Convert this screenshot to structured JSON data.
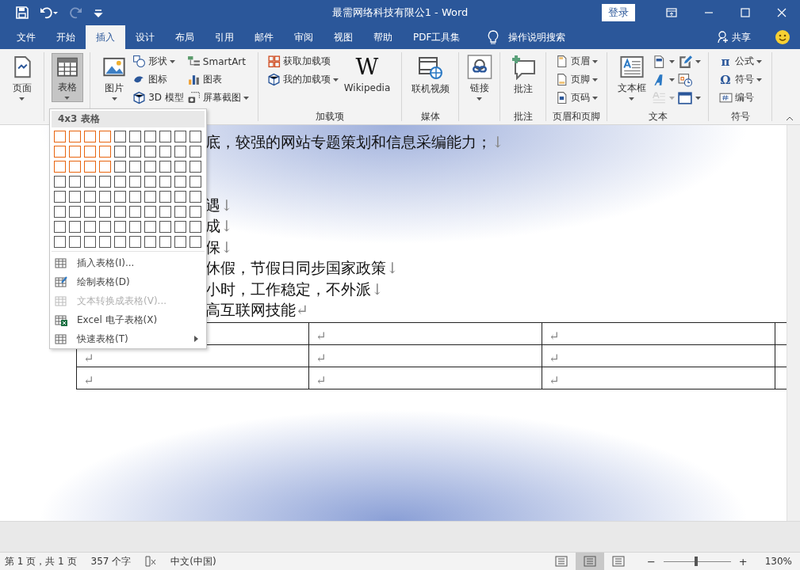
{
  "window": {
    "title": "最需网络科技有限公1  -  Word",
    "login": "登录"
  },
  "tabs": [
    {
      "label": "文件",
      "selected": false
    },
    {
      "label": "开始",
      "selected": false
    },
    {
      "label": "插入",
      "selected": true
    },
    {
      "label": "设计",
      "selected": false
    },
    {
      "label": "布局",
      "selected": false
    },
    {
      "label": "引用",
      "selected": false
    },
    {
      "label": "邮件",
      "selected": false
    },
    {
      "label": "审阅",
      "selected": false
    },
    {
      "label": "视图",
      "selected": false
    },
    {
      "label": "帮助",
      "selected": false
    },
    {
      "label": "PDF工具集",
      "selected": false
    }
  ],
  "tell_me": "操作说明搜索",
  "share": "共享",
  "ribbon": {
    "groups": [
      {
        "columns": [
          [
            {
              "kind": "large",
              "label": "页面",
              "dropdown": true,
              "pressed": false
            }
          ]
        ]
      },
      {
        "columns": [
          [
            {
              "kind": "large",
              "label": "表格",
              "dropdown": true,
              "pressed": true
            }
          ]
        ]
      },
      {
        "columns": [
          [
            {
              "kind": "large",
              "label": "图片",
              "dropdown": true,
              "pressed": false
            }
          ],
          [
            {
              "kind": "small",
              "label": "形状",
              "dropdown": true
            },
            {
              "kind": "small",
              "label": "图标",
              "dropdown": false
            },
            {
              "kind": "small",
              "label": "3D 模型",
              "dropdown": false
            }
          ],
          [
            {
              "kind": "small",
              "label": "SmartArt",
              "dropdown": false
            },
            {
              "kind": "small",
              "label": "图表",
              "dropdown": false
            },
            {
              "kind": "small",
              "label": "屏幕截图",
              "dropdown": true
            }
          ]
        ]
      },
      {
        "label": "加载项",
        "columns": [
          [
            {
              "kind": "small",
              "label": "获取加载项",
              "dropdown": false
            },
            {
              "kind": "small",
              "label": "我的加载项",
              "dropdown": true
            }
          ],
          [
            {
              "kind": "large",
              "label": "Wikipedia",
              "glyph": "W",
              "dropdown": false,
              "pressed": false
            }
          ]
        ]
      },
      {
        "label": "媒体",
        "columns": [
          [
            {
              "kind": "large",
              "label": "联机视频",
              "dropdown": false,
              "pressed": false
            }
          ]
        ]
      },
      {
        "columns": [
          [
            {
              "kind": "large",
              "label": "链接",
              "dropdown": true,
              "pressed": false
            }
          ]
        ]
      },
      {
        "label": "批注",
        "columns": [
          [
            {
              "kind": "large",
              "label": "批注",
              "dropdown": false,
              "pressed": false
            }
          ]
        ]
      },
      {
        "label": "页眉和页脚",
        "columns": [
          [
            {
              "kind": "small",
              "label": "页眉",
              "dropdown": true
            },
            {
              "kind": "small",
              "label": "页脚",
              "dropdown": true
            },
            {
              "kind": "small",
              "label": "页码",
              "dropdown": true
            }
          ]
        ]
      },
      {
        "label": "文本",
        "columns": [
          [
            {
              "kind": "large",
              "label": "文本框",
              "dropdown": true,
              "pressed": false
            }
          ],
          [
            {
              "kind": "icon",
              "dropdown": true,
              "disabled": false
            },
            {
              "kind": "icon",
              "dropdown": true,
              "disabled": false
            },
            {
              "kind": "icon",
              "dropdown": true,
              "disabled": true
            }
          ],
          [
            {
              "kind": "icon",
              "dropdown": true,
              "disabled": false
            },
            {
              "kind": "icon",
              "dropdown": false,
              "disabled": false
            },
            {
              "kind": "icon",
              "dropdown": true,
              "disabled": false
            }
          ]
        ]
      },
      {
        "label": "符号",
        "columns": [
          [
            {
              "kind": "small",
              "label": "公式",
              "glyph": "π",
              "dropdown": true
            },
            {
              "kind": "small",
              "label": "符号",
              "glyph": "Ω",
              "dropdown": true
            },
            {
              "kind": "small",
              "label": "编号",
              "dropdown": false
            }
          ]
        ]
      }
    ]
  },
  "table_menu": {
    "title": "4x3 表格",
    "grid": [
      [
        {
          "selected": true
        },
        {
          "selected": true
        },
        {
          "selected": true
        },
        {
          "selected": true
        },
        {
          "selected": false
        },
        {
          "selected": false
        },
        {
          "selected": false
        },
        {
          "selected": false
        },
        {
          "selected": false
        },
        {
          "selected": false
        }
      ],
      [
        {
          "selected": true
        },
        {
          "selected": true
        },
        {
          "selected": true
        },
        {
          "selected": true
        },
        {
          "selected": false
        },
        {
          "selected": false
        },
        {
          "selected": false
        },
        {
          "selected": false
        },
        {
          "selected": false
        },
        {
          "selected": false
        }
      ],
      [
        {
          "selected": true
        },
        {
          "selected": true
        },
        {
          "selected": true
        },
        {
          "selected": true
        },
        {
          "selected": false
        },
        {
          "selected": false
        },
        {
          "selected": false
        },
        {
          "selected": false
        },
        {
          "selected": false
        },
        {
          "selected": false
        }
      ],
      [
        {
          "selected": false
        },
        {
          "selected": false
        },
        {
          "selected": false
        },
        {
          "selected": false
        },
        {
          "selected": false
        },
        {
          "selected": false
        },
        {
          "selected": false
        },
        {
          "selected": false
        },
        {
          "selected": false
        },
        {
          "selected": false
        }
      ],
      [
        {
          "selected": false
        },
        {
          "selected": false
        },
        {
          "selected": false
        },
        {
          "selected": false
        },
        {
          "selected": false
        },
        {
          "selected": false
        },
        {
          "selected": false
        },
        {
          "selected": false
        },
        {
          "selected": false
        },
        {
          "selected": false
        }
      ],
      [
        {
          "selected": false
        },
        {
          "selected": false
        },
        {
          "selected": false
        },
        {
          "selected": false
        },
        {
          "selected": false
        },
        {
          "selected": false
        },
        {
          "selected": false
        },
        {
          "selected": false
        },
        {
          "selected": false
        },
        {
          "selected": false
        }
      ],
      [
        {
          "selected": false
        },
        {
          "selected": false
        },
        {
          "selected": false
        },
        {
          "selected": false
        },
        {
          "selected": false
        },
        {
          "selected": false
        },
        {
          "selected": false
        },
        {
          "selected": false
        },
        {
          "selected": false
        },
        {
          "selected": false
        }
      ],
      [
        {
          "selected": false
        },
        {
          "selected": false
        },
        {
          "selected": false
        },
        {
          "selected": false
        },
        {
          "selected": false
        },
        {
          "selected": false
        },
        {
          "selected": false
        },
        {
          "selected": false
        },
        {
          "selected": false
        },
        {
          "selected": false
        }
      ]
    ],
    "items": [
      {
        "label": "插入表格(I)...",
        "disabled": false,
        "submenu": false
      },
      {
        "label": "绘制表格(D)",
        "disabled": false,
        "submenu": false
      },
      {
        "label": "文本转换成表格(V)...",
        "disabled": true,
        "submenu": false
      },
      {
        "label": "Excel 电子表格(X)",
        "disabled": false,
        "submenu": false
      },
      {
        "label": "快速表格(T)",
        "disabled": false,
        "submenu": true
      }
    ]
  },
  "document": {
    "lines": [
      {
        "text": "底，较强的网站专题策划和信息采编能力；",
        "mark": "↓"
      },
      {
        "kind": "blank"
      },
      {
        "kind": "blank"
      },
      {
        "text": "遇",
        "mark": "↓"
      },
      {
        "text": "成",
        "mark": "↓"
      },
      {
        "text": "保",
        "mark": "↓"
      },
      {
        "text": "休假，节假日同步国家政策",
        "mark": "↓"
      },
      {
        "text": "小时，工作稳定，不外派",
        "mark": "↓"
      },
      {
        "text": "高互联网技能",
        "mark": "↵"
      }
    ],
    "table": [
      [
        "↵",
        "↵"
      ],
      [
        "↵",
        "↵",
        "↵"
      ],
      [
        "↵",
        "↵",
        "↵"
      ]
    ]
  },
  "status_bar": {
    "page": "第 1 页，共 1 页",
    "words": "357 个字",
    "language": "中文(中国)",
    "views": [
      {
        "selected": false
      },
      {
        "selected": true
      },
      {
        "selected": false
      }
    ],
    "zoom_out": "−",
    "zoom_in": "+",
    "zoom": {
      "level": 0.48
    },
    "zoom_text": "130%"
  }
}
